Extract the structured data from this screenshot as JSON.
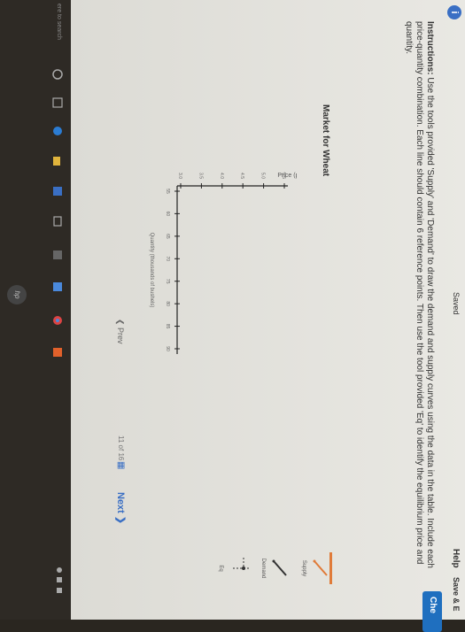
{
  "header": {
    "saved_label": "Saved",
    "help_label": "Help",
    "save_exit_label": "Save & E",
    "check_label": "Che"
  },
  "instructions": {
    "lead": "Instructions:",
    "text": "Use the tools provided 'Supply' and 'Demand' to draw the demand and supply curves using the data in the table. Include each price-quantity combination. Each line should contain 6 reference points. Then use the tool provided 'Eq' to identify the equilibrium price and quantity."
  },
  "chart_title": "Market for Wheat",
  "tools": {
    "supply_label": "Supply",
    "demand_label": "Demand",
    "eq_label": "Eq"
  },
  "colors": {
    "accent": "#3a6fc4",
    "supply": "#e07b39",
    "demand": "#333333",
    "button": "#1f6fbf"
  },
  "chart_data": {
    "type": "line",
    "title": "Market for Wheat",
    "xlabel": "Quantity (thousands of bushels)",
    "ylabel": "Price (per bushel)",
    "y_ticks": [
      "5.5",
      "5.0",
      "4.5",
      "4.0",
      "3.5",
      "3.0"
    ],
    "x_ticks": [
      "55",
      "60",
      "65",
      "70",
      "75",
      "80",
      "85",
      "90"
    ],
    "series": []
  },
  "navigation": {
    "prev_label": "Prev",
    "page_current": "11",
    "page_of": "of",
    "page_total": "16",
    "next_label": "Next"
  },
  "taskbar": {
    "search_text": "ere to search"
  }
}
